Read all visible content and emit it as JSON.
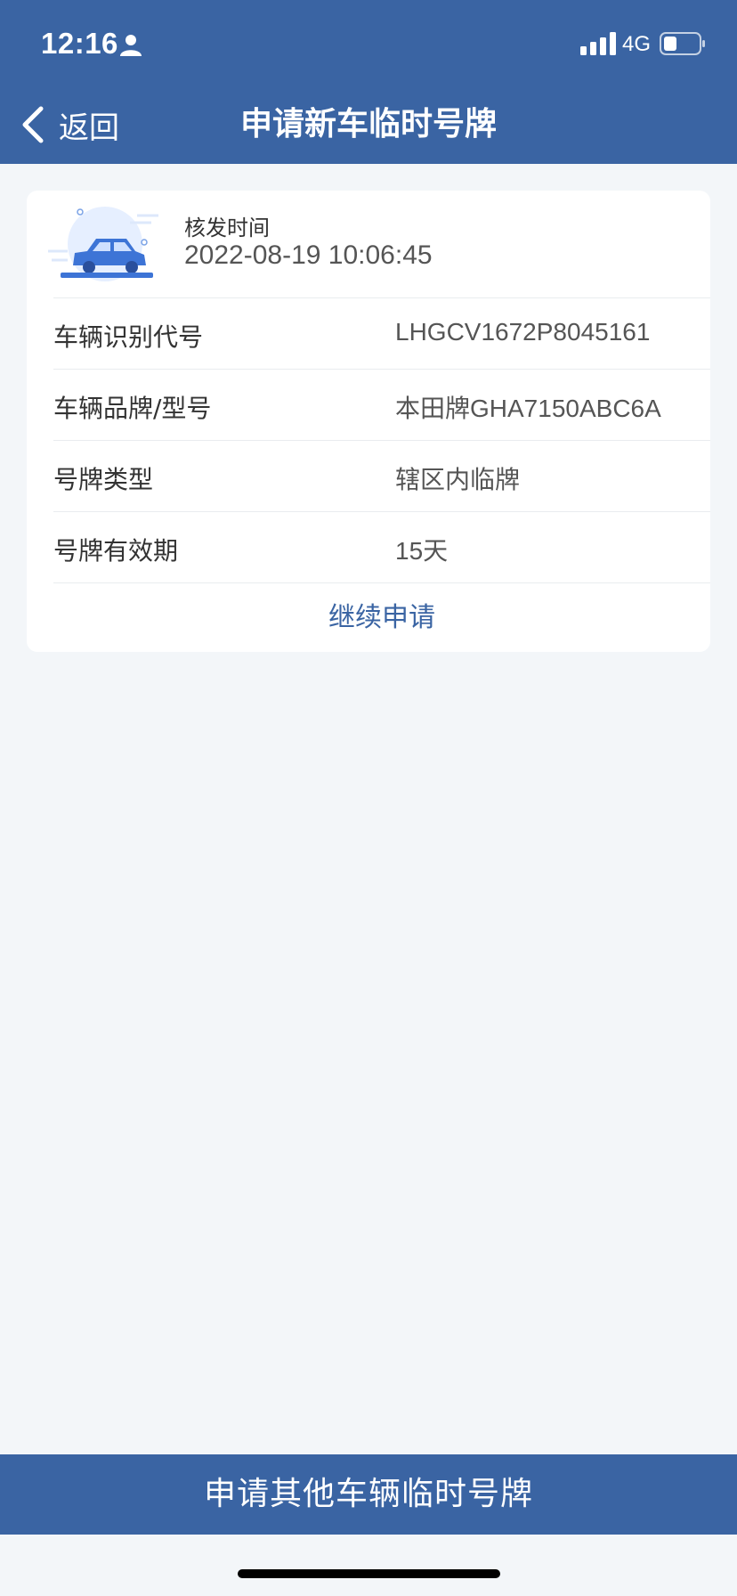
{
  "status_bar": {
    "time": "12:16",
    "network": "4G",
    "icons": [
      "person-icon",
      "signal-icon",
      "battery-icon"
    ]
  },
  "nav": {
    "back_label": "返回",
    "title": "申请新车临时号牌",
    "back_icon": "chevron-left-icon"
  },
  "card": {
    "issue_label": "核发时间",
    "issue_time": "2022-08-19 10:06:45",
    "illustration": "car-illustration",
    "rows": [
      {
        "label": "车辆识别代号",
        "value": "LHGCV1672P8045161"
      },
      {
        "label": "车辆品牌/型号",
        "value": "本田牌GHA7150ABC6A"
      },
      {
        "label": "号牌类型",
        "value": "辖区内临牌"
      },
      {
        "label": "号牌有效期",
        "value": "15天"
      }
    ],
    "continue_label": "继续申请"
  },
  "bottom_button_label": "申请其他车辆临时号牌",
  "colors": {
    "primary": "#3a64a3",
    "background": "#f3f6f9",
    "card": "#ffffff"
  }
}
